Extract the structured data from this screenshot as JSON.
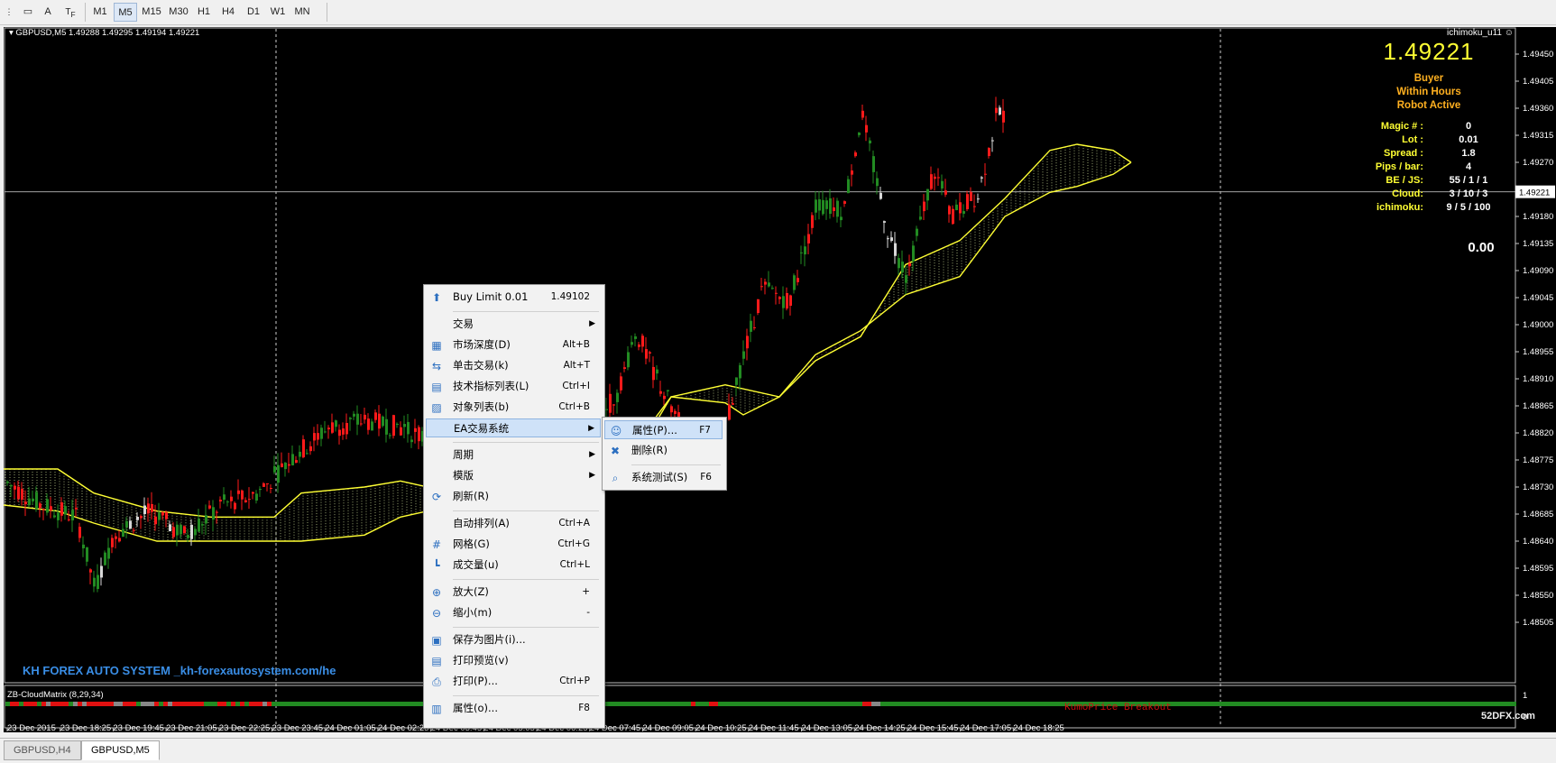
{
  "toolbar": {
    "periods": [
      "M1",
      "M5",
      "M15",
      "M30",
      "H1",
      "H4",
      "D1",
      "W1",
      "MN"
    ],
    "active_period": "M5",
    "text_tool": "A"
  },
  "chart": {
    "header": "GBPUSD,M5  1.49288 1.49295 1.49194 1.49221",
    "indicator_name": "ichimoku_u11",
    "price": "1.49221",
    "status": [
      "Buyer",
      "Within Hours",
      "Robot Active"
    ],
    "params": [
      {
        "label": "Magic # :",
        "value": "0"
      },
      {
        "label": "Lot :",
        "value": "0.01"
      },
      {
        "label": "Spread :",
        "value": "1.8"
      },
      {
        "label": "Pips / bar:",
        "value": "4"
      },
      {
        "label": "BE / JS:",
        "value": "55 / 1 / 1"
      },
      {
        "label": "Cloud:",
        "value": "3 / 10 / 3"
      },
      {
        "label": "ichimoku:",
        "value": "9 / 5 / 100"
      }
    ],
    "profit": "0.00",
    "watermark": "KH FOREX AUTO SYSTEM _kh-forexautosystem.com/he",
    "y_ticks": [
      "1.49450",
      "1.49405",
      "1.49360",
      "1.49315",
      "1.49270",
      "1.49180",
      "1.49135",
      "1.49090",
      "1.49045",
      "1.49000",
      "1.48955",
      "1.48910",
      "1.48865",
      "1.48820",
      "1.48775",
      "1.48730",
      "1.48685",
      "1.48640",
      "1.48595",
      "1.48550",
      "1.48505"
    ],
    "current_price_tag": "1.49221",
    "x_ticks": [
      "23 Dec 2015",
      "23 Dec 18:25",
      "23 Dec 19:45",
      "23 Dec 21:05",
      "23 Dec 22:25",
      "23 Dec 23:45",
      "24 Dec 01:05",
      "24 Dec 02:25",
      "24 Dec 03:45",
      "24 Dec 05:05",
      "24 Dec 06:25",
      "24 Dec 07:45",
      "24 Dec 09:05",
      "24 Dec 10:25",
      "24 Dec 11:45",
      "24 Dec 13:05",
      "24 Dec 14:25",
      "24 Dec 15:45",
      "24 Dec 17:05",
      "24 Dec 18:25"
    ],
    "sub_indicator": "ZB-CloudMatrix (8,29,34)",
    "sub_label": "KumoPrice Breakout",
    "sub_ticks": [
      "1",
      "0"
    ],
    "corner_mark": "52DFX.com"
  },
  "context_menu": [
    {
      "icon": "up-arrow-icon",
      "glyph": "⬆",
      "label": "Buy Limit 0.01",
      "shortcut": "1.49102"
    },
    {
      "sep": true
    },
    {
      "label": "交易",
      "submenu": true
    },
    {
      "icon": "market-depth-icon",
      "glyph": "▦",
      "label": "市场深度(D)",
      "shortcut": "Alt+B"
    },
    {
      "icon": "one-click-trading-icon",
      "glyph": "⇆",
      "label": "单击交易(k)",
      "shortcut": "Alt+T"
    },
    {
      "icon": "indicator-list-icon",
      "glyph": "▤",
      "label": "技术指标列表(L)",
      "shortcut": "Ctrl+I"
    },
    {
      "icon": "object-list-icon",
      "glyph": "▨",
      "label": "对象列表(b)",
      "shortcut": "Ctrl+B"
    },
    {
      "label": "EA交易系统",
      "submenu": true,
      "highlight": true
    },
    {
      "sep": true
    },
    {
      "label": "周期",
      "submenu": true
    },
    {
      "label": "模版",
      "submenu": true
    },
    {
      "icon": "refresh-icon",
      "glyph": "⟳",
      "label": "刷新(R)"
    },
    {
      "sep": true
    },
    {
      "label": "自动排列(A)",
      "shortcut": "Ctrl+A"
    },
    {
      "icon": "grid-icon",
      "glyph": "#",
      "label": "网格(G)",
      "shortcut": "Ctrl+G"
    },
    {
      "icon": "volumes-icon",
      "glyph": "┗",
      "label": "成交量(u)",
      "shortcut": "Ctrl+L"
    },
    {
      "sep": true
    },
    {
      "icon": "zoom-in-icon",
      "glyph": "⊕",
      "label": "放大(Z)",
      "shortcut": "+"
    },
    {
      "icon": "zoom-out-icon",
      "glyph": "⊖",
      "label": "缩小(m)",
      "shortcut": "-"
    },
    {
      "sep": true
    },
    {
      "icon": "save-picture-icon",
      "glyph": "▣",
      "label": "保存为图片(i)..."
    },
    {
      "icon": "print-preview-icon",
      "glyph": "▤",
      "label": "打印预览(v)"
    },
    {
      "icon": "print-icon",
      "glyph": "⎙",
      "label": "打印(P)...",
      "shortcut": "Ctrl+P"
    },
    {
      "sep": true
    },
    {
      "icon": "properties-icon",
      "glyph": "▥",
      "label": "属性(o)...",
      "shortcut": "F8"
    }
  ],
  "submenu": [
    {
      "icon": "ea-properties-icon",
      "glyph": "☺",
      "label": "属性(P)...",
      "shortcut": "F7",
      "highlight": true
    },
    {
      "icon": "ea-remove-icon",
      "glyph": "✖",
      "label": "删除(R)"
    },
    {
      "sep": true
    },
    {
      "icon": "strategy-tester-icon",
      "glyph": "⌕",
      "label": "系统测试(S)",
      "shortcut": "F6"
    }
  ],
  "tabs": [
    {
      "label": "GBPUSD,H4",
      "selected": false
    },
    {
      "label": "GBPUSD,M5",
      "selected": true
    }
  ],
  "colors": {
    "bull": "#228b22",
    "bear": "#ff1a1a",
    "cloud_line": "#ffff33",
    "price_text": "#ffff33",
    "status_text": "#ffb020",
    "label_text": "#ffff33",
    "value_text": "#ffffff",
    "watermark": "#3a8ee6",
    "sub_label": "#d01010"
  }
}
